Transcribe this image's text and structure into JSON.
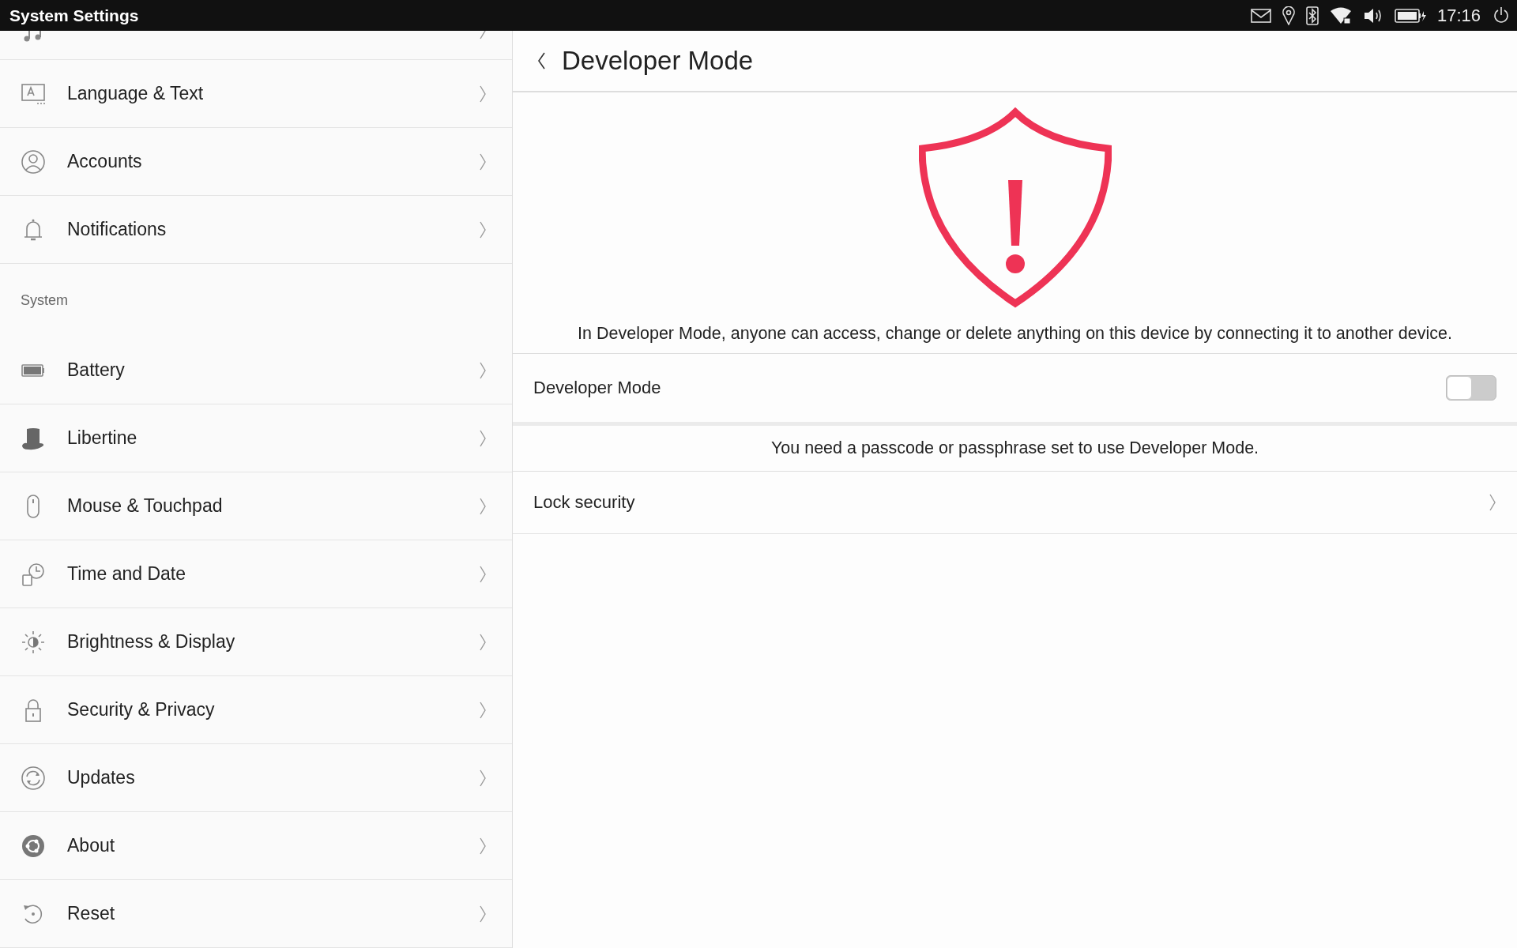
{
  "top_bar": {
    "title": "System Settings",
    "time": "17:16"
  },
  "sidebar": {
    "items": [
      {
        "kind": "partial"
      },
      {
        "kind": "item",
        "label": "Language & Text"
      },
      {
        "kind": "item",
        "label": "Accounts"
      },
      {
        "kind": "item",
        "label": "Notifications"
      },
      {
        "kind": "header",
        "label": "System"
      },
      {
        "kind": "item",
        "label": "Battery"
      },
      {
        "kind": "item",
        "label": "Libertine"
      },
      {
        "kind": "item",
        "label": "Mouse & Touchpad"
      },
      {
        "kind": "item",
        "label": "Time and Date"
      },
      {
        "kind": "item",
        "label": "Brightness & Display"
      },
      {
        "kind": "item",
        "label": "Security & Privacy"
      },
      {
        "kind": "item",
        "label": "Updates"
      },
      {
        "kind": "item",
        "label": "About"
      },
      {
        "kind": "item",
        "label": "Reset"
      }
    ]
  },
  "page": {
    "title": "Developer Mode",
    "warning": "In Developer Mode, anyone can access, change or delete anything on this device by connecting it to another device.",
    "developer_mode": {
      "label": "Developer Mode",
      "on": false
    },
    "note": "You need a passcode or passphrase set to use Developer Mode.",
    "lock_security": {
      "label": "Lock security"
    }
  }
}
